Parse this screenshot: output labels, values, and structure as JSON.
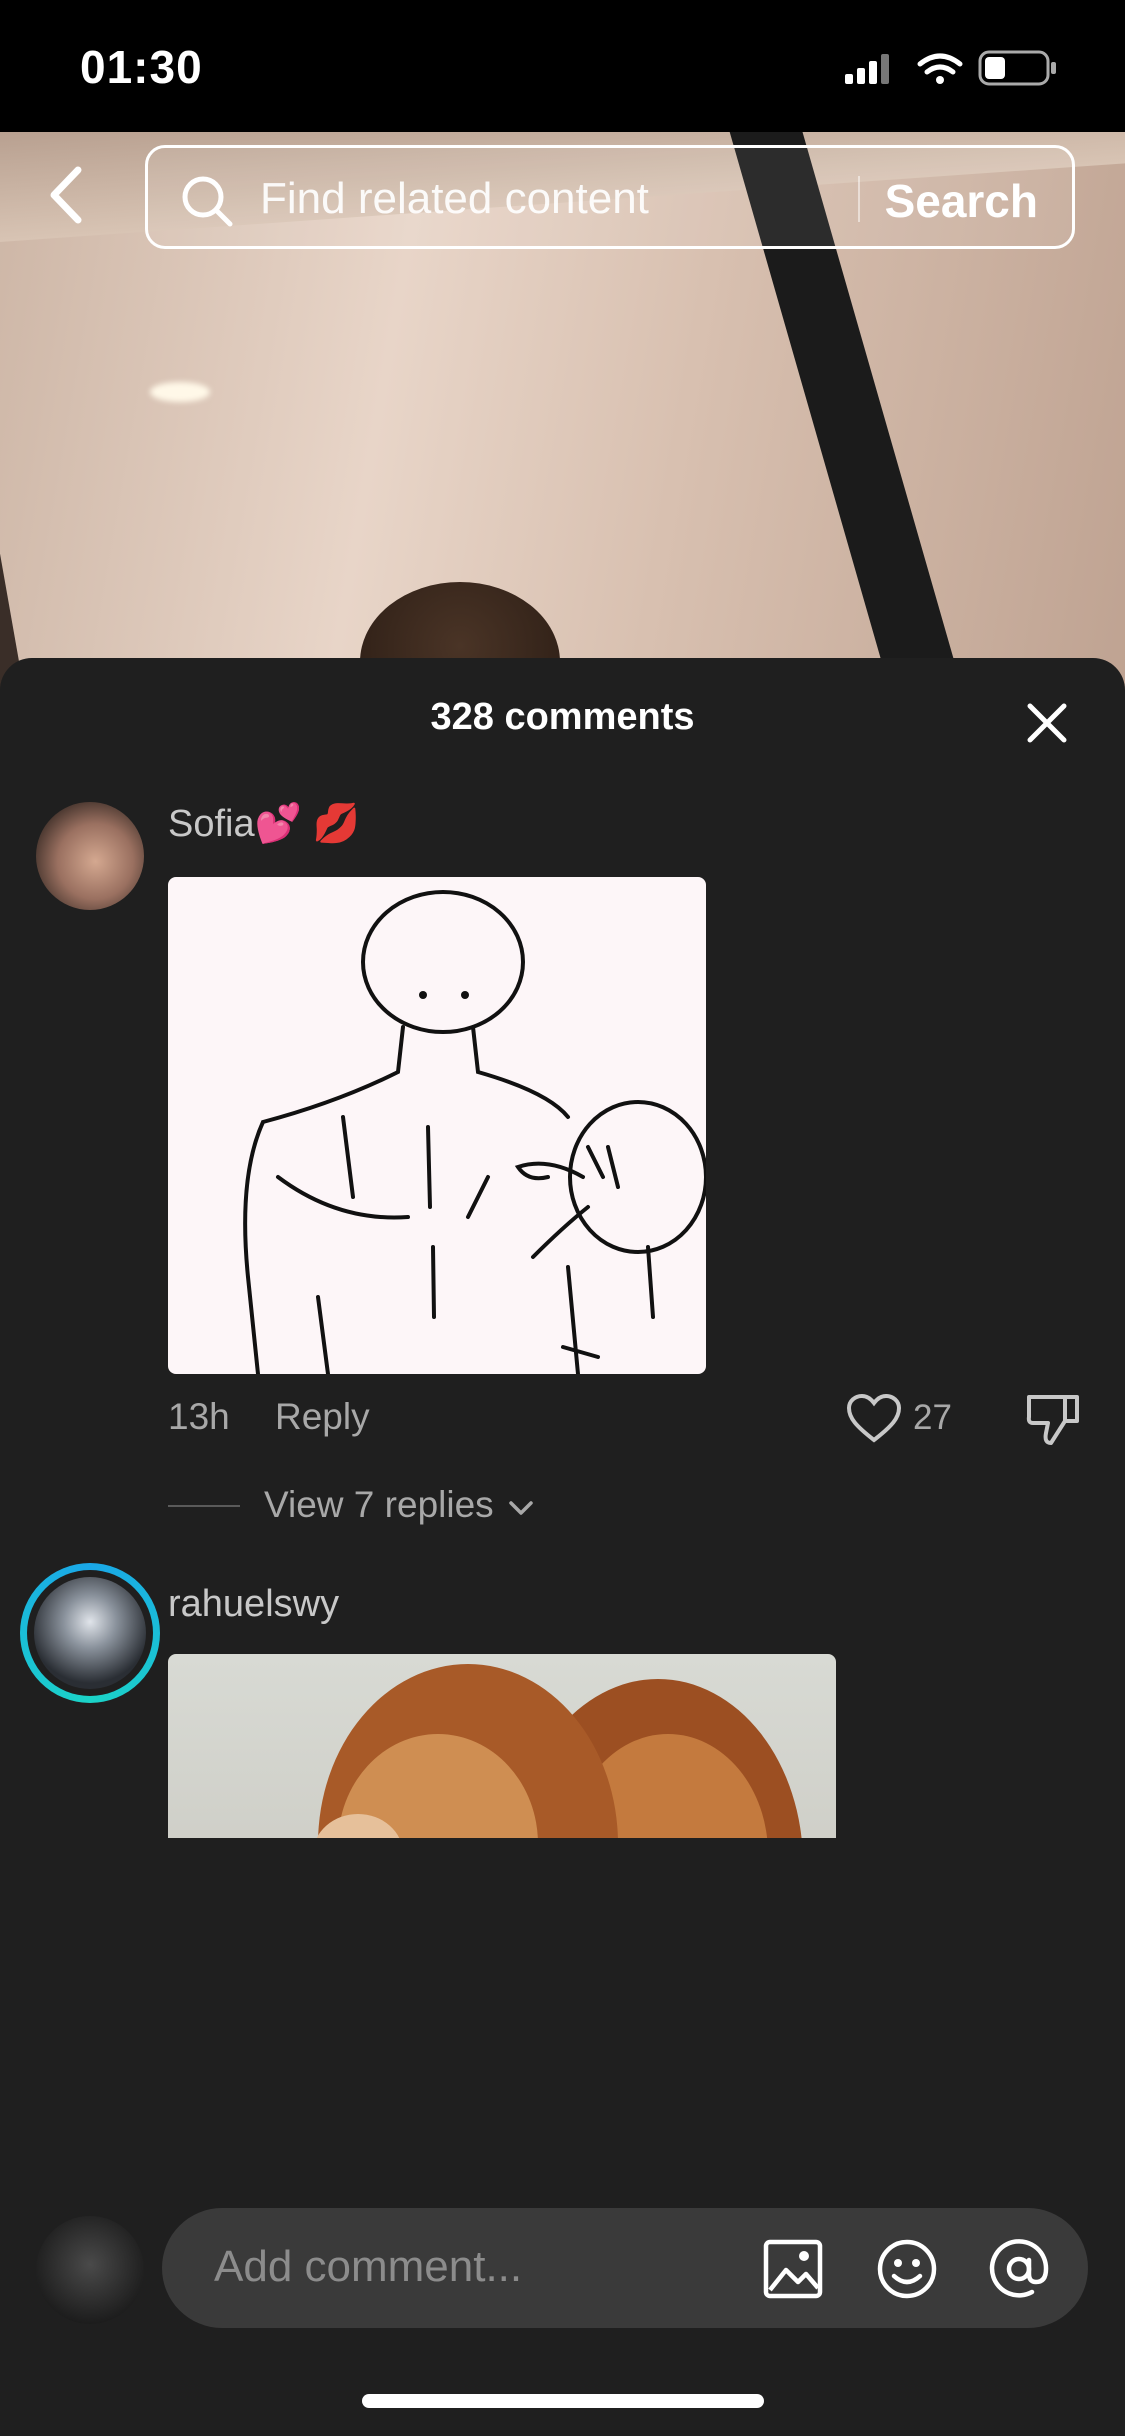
{
  "status_bar": {
    "time": "01:30"
  },
  "search": {
    "placeholder": "Find related content",
    "button": "Search"
  },
  "sheet": {
    "title": "328 comments"
  },
  "comments": [
    {
      "username": "Sofia💕 💋",
      "time": "13h",
      "reply": "Reply",
      "likes": "27",
      "view_replies": "View 7 replies"
    },
    {
      "username": "rahuelswy"
    }
  ],
  "composer": {
    "placeholder": "Add comment..."
  },
  "icons": {
    "back": "chevron-left-icon",
    "search": "search-icon",
    "close": "close-icon",
    "like": "heart-icon",
    "dislike": "thumbs-down-icon",
    "image": "image-icon",
    "emoji": "emoji-icon",
    "mention": "at-icon",
    "chevron": "chevron-down-icon"
  },
  "colors": {
    "sheet_bg": "#1f1f1f",
    "story_ring": "#1aa7e8"
  }
}
